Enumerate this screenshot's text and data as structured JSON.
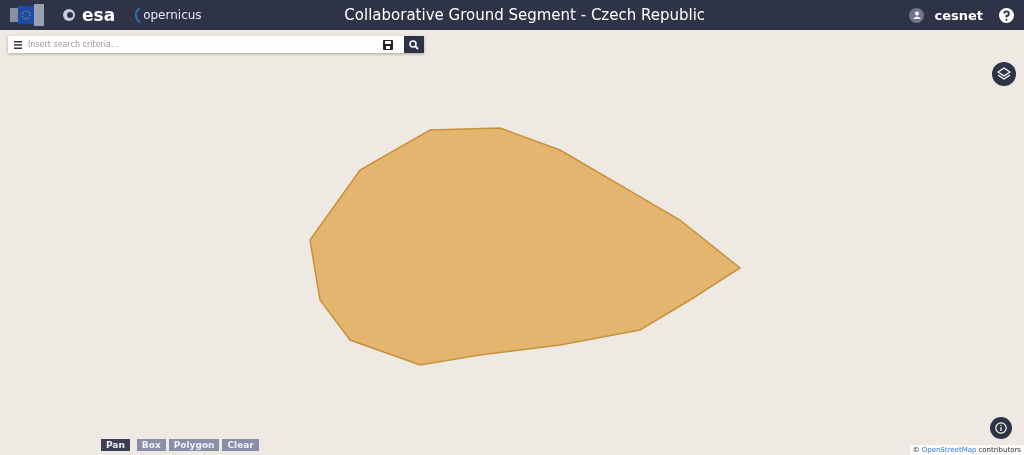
{
  "header": {
    "logos": [
      "esa",
      "opernicus"
    ],
    "title": "Collaborative Ground Segment - Czech Republic",
    "brand": "cesnet"
  },
  "search": {
    "placeholder": "Insert search criteria..."
  },
  "draw_tools": [
    {
      "label": "Pan",
      "selected": true
    },
    {
      "label": "Box",
      "selected": false
    },
    {
      "label": "Polygon",
      "selected": false
    },
    {
      "label": "Clear",
      "selected": false
    }
  ],
  "attribution": {
    "symbol": "©",
    "link": "OpenStreetMap",
    "text": "contributors"
  }
}
